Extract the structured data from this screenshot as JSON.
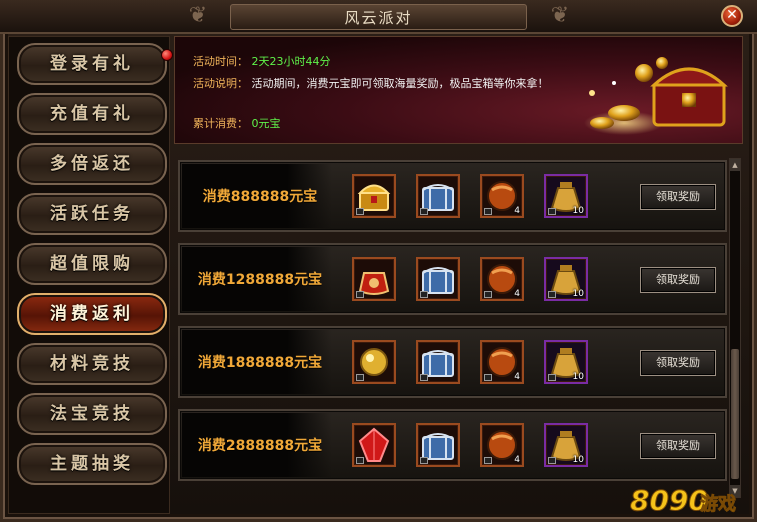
{
  "window": {
    "title": "风云派对"
  },
  "sidebar": {
    "items": [
      {
        "label": "登录有礼",
        "active": false,
        "notify": true
      },
      {
        "label": "充值有礼",
        "active": false
      },
      {
        "label": "多倍返还",
        "active": false
      },
      {
        "label": "活跃任务",
        "active": false
      },
      {
        "label": "超值限购",
        "active": false
      },
      {
        "label": "消费返利",
        "active": true
      },
      {
        "label": "材料竞技",
        "active": false
      },
      {
        "label": "法宝竞技",
        "active": false
      },
      {
        "label": "主题抽奖",
        "active": false
      }
    ]
  },
  "event": {
    "time_label": "活动时间：",
    "time_value": "2天23小时44分",
    "desc_label": "活动说明：",
    "desc_value": "活动期间，消费元宝即可领取海量奖励，极品宝箱等你来拿！",
    "spent_label": "累计消费：",
    "spent_value": "0元宝"
  },
  "rewards": [
    {
      "label": "消费888888元宝",
      "items": [
        {
          "icon": "golden-chest-icon",
          "qty": ""
        },
        {
          "icon": "silver-chest-icon",
          "qty": ""
        },
        {
          "icon": "orange-orb-icon",
          "qty": "4"
        },
        {
          "icon": "gold-pouch-icon",
          "qty": "10"
        }
      ],
      "button": "领取奖励"
    },
    {
      "label": "消费1288888元宝",
      "items": [
        {
          "icon": "red-pouch-icon",
          "qty": ""
        },
        {
          "icon": "silver-chest-icon",
          "qty": ""
        },
        {
          "icon": "orange-orb-icon",
          "qty": "4"
        },
        {
          "icon": "gold-pouch-icon",
          "qty": "10"
        }
      ],
      "button": "领取奖励"
    },
    {
      "label": "消费1888888元宝",
      "items": [
        {
          "icon": "golden-orb-icon",
          "qty": ""
        },
        {
          "icon": "silver-chest-icon",
          "qty": ""
        },
        {
          "icon": "orange-orb-icon",
          "qty": "4"
        },
        {
          "icon": "gold-pouch-icon",
          "qty": "10"
        }
      ],
      "button": "领取奖励"
    },
    {
      "label": "消费2888888元宝",
      "items": [
        {
          "icon": "red-crystal-icon",
          "qty": ""
        },
        {
          "icon": "silver-chest-icon",
          "qty": ""
        },
        {
          "icon": "orange-orb-icon",
          "qty": "4"
        },
        {
          "icon": "gold-pouch-icon",
          "qty": "10"
        }
      ],
      "button": "领取奖励"
    }
  ],
  "watermark": {
    "text": "8090游戏"
  },
  "colors": {
    "accent_orange": "#f0a838",
    "value_green": "#5ff24a",
    "active_red": "#8e2a10"
  }
}
